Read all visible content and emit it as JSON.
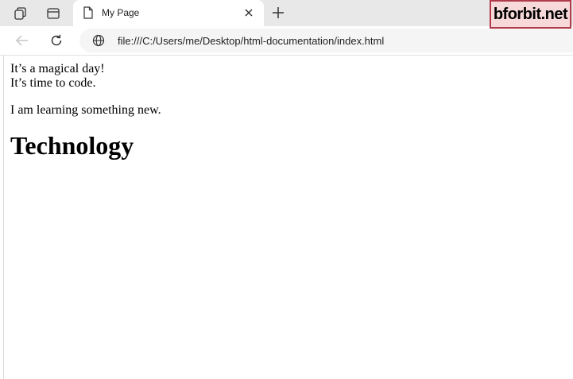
{
  "browser": {
    "tab": {
      "title": "My Page"
    },
    "address_bar": {
      "url": "file:///C:/Users/me/Desktop/html-documentation/index.html"
    },
    "watermark": "bforbit.net"
  },
  "page": {
    "line1": "It’s a magical day!",
    "line2": "It’s time to code.",
    "paragraph": "I am learning something new.",
    "heading": "Technology"
  },
  "icons": {
    "workspaces": "workspaces-icon",
    "tab_actions": "tab-actions-icon",
    "page": "page-icon",
    "close": "close-icon",
    "new_tab": "plus-icon",
    "back": "back-arrow-icon",
    "refresh": "refresh-icon",
    "site_info": "globe-icon"
  }
}
